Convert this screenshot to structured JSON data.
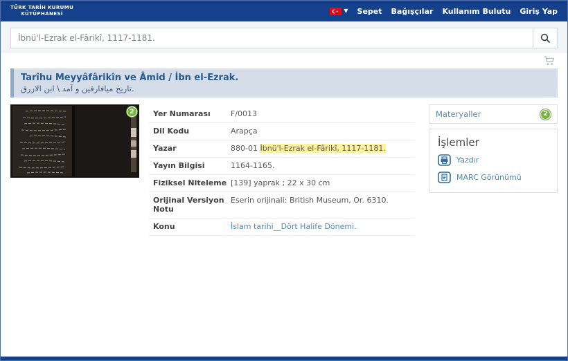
{
  "header": {
    "logo_line1": "TÜRK TARİH KURUMU",
    "logo_line2": "KÜTÜPHANESİ",
    "nav_items": [
      "Sepet",
      "Bağışçılar",
      "Kullanım Bulutu",
      "Giriş Yap"
    ]
  },
  "search": {
    "value": "İbnü'l-Ezrak el-Fârikî, 1117-1181."
  },
  "record": {
    "title": "Tarîhu Meyyâfârikîn ve Âmid / İbn el-Ezrak.",
    "title_alt": "تاريخ ميافارقين و آمد \\ ابن الازرق.",
    "cover_badge_count": "2",
    "fields": [
      {
        "label": "Yer Numarası",
        "value": "F/0013"
      },
      {
        "label": "Dil Kodu",
        "value": "Arapça"
      },
      {
        "label": "Yazar",
        "parts": [
          {
            "text": "880-01 "
          },
          {
            "text": "İbnü'l-Ezrak el-Fârikî, 1117-1181.",
            "highlight": true
          }
        ]
      },
      {
        "label": "Yayın Bilgisi",
        "value": "1164-1165."
      },
      {
        "label": "Fiziksel Niteleme",
        "value": "[139] yaprak ; 22 x 30 cm"
      },
      {
        "label": "Orijinal Versiyon Notu",
        "value": "Eserin orijinali: British Museum, Or. 6310."
      },
      {
        "label": "Konu",
        "value": "İslam tarihi__Dört Halife Dönemi.",
        "link": true
      }
    ]
  },
  "sidebar": {
    "materials_label": "Materyaller",
    "materials_count": "2",
    "actions_title": "İşlemler",
    "actions": [
      {
        "label": "Yazdır",
        "icon": "printer-icon"
      },
      {
        "label": "MARC Görünümü",
        "icon": "marc-document-icon"
      }
    ]
  },
  "colors": {
    "navy": "#14408c",
    "title_bg": "#d5dde8",
    "badge_green": "#77b33e",
    "link_blue": "#4e8cad",
    "icon_blue": "#2d6da3",
    "highlight_yellow": "#fcf3a1",
    "flag_red": "#e30a17"
  }
}
